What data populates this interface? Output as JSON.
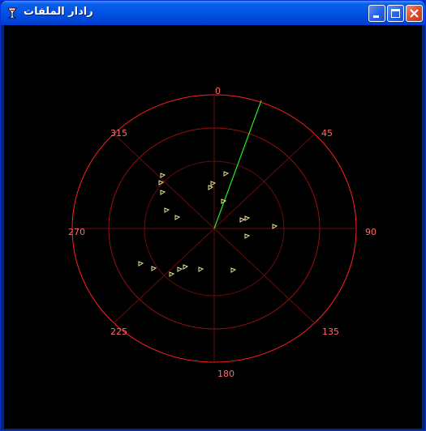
{
  "window": {
    "title": "رادار الملفات",
    "buttons": {
      "minimize": "minimize",
      "maximize": "maximize",
      "close": "close"
    }
  },
  "radar": {
    "bearing_labels": {
      "b0": "0",
      "b45": "45",
      "b90": "90",
      "b135": "135",
      "b180": "180",
      "b225": "225",
      "b270": "270",
      "b315": "315"
    },
    "ring_color": "#ff2020",
    "sweep_color": "#22ee22",
    "blip_color": "#e6e69a",
    "blip_icon": "triangle-blip-icon",
    "sweep_bearing_deg": 21
  }
}
